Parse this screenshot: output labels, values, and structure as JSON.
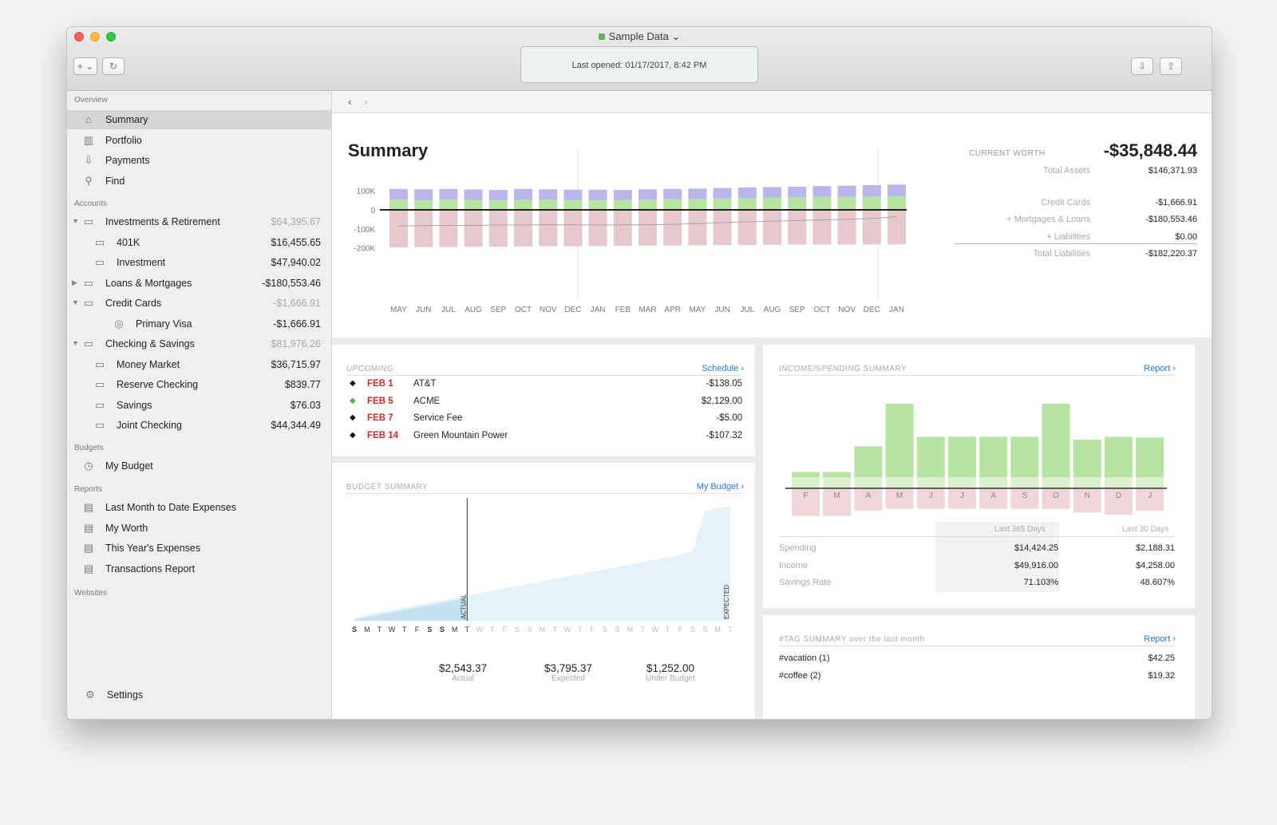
{
  "window": {
    "title": "Sample Data",
    "last_opened": "Last opened:  01/17/2017, 8:42 PM"
  },
  "toolbar": {
    "add_label": "+ ⌄",
    "refresh_icon": "refresh-icon",
    "import_icon": "import-icon",
    "export_icon": "export-icon"
  },
  "sidebar": {
    "overview_header": "Overview",
    "overview": [
      {
        "label": "Summary",
        "icon": "house-icon"
      },
      {
        "label": "Portfolio",
        "icon": "chart-icon"
      },
      {
        "label": "Payments",
        "icon": "tray-icon"
      },
      {
        "label": "Find",
        "icon": "magnifier-icon"
      }
    ],
    "accounts_header": "Accounts",
    "accounts": [
      {
        "label": "Investments & Retirement",
        "amount": "$64,395.67",
        "level": 0,
        "expander": "▼"
      },
      {
        "label": "401K",
        "amount": "$16,455.65",
        "level": 1,
        "expander": ""
      },
      {
        "label": "Investment",
        "amount": "$47,940.02",
        "level": 1,
        "expander": ""
      },
      {
        "label": "Loans & Mortgages",
        "amount": "-$180,553.46",
        "level": 0,
        "expander": "▶"
      },
      {
        "label": "Credit Cards",
        "amount": "-$1,666.91",
        "level": 0,
        "expander": "▼"
      },
      {
        "label": "Primary Visa",
        "amount": "-$1,666.91",
        "level": 2,
        "expander": ""
      },
      {
        "label": "Checking & Savings",
        "amount": "$81,976.26",
        "level": 0,
        "expander": "▼"
      },
      {
        "label": "Money Market",
        "amount": "$36,715.97",
        "level": 1,
        "expander": ""
      },
      {
        "label": "Reserve Checking",
        "amount": "$839.77",
        "level": 1,
        "expander": ""
      },
      {
        "label": "Savings",
        "amount": "$76.03",
        "level": 1,
        "expander": ""
      },
      {
        "label": "Joint Checking",
        "amount": "$44,344.49",
        "level": 1,
        "expander": ""
      }
    ],
    "budgets_header": "Budgets",
    "budgets": [
      {
        "label": "My Budget"
      }
    ],
    "reports_header": "Reports",
    "reports": [
      {
        "label": "Last Month to Date Expenses"
      },
      {
        "label": "My Worth"
      },
      {
        "label": "This Year's Expenses"
      },
      {
        "label": "Transactions Report"
      }
    ],
    "websites_header": "Websites",
    "settings_label": "Settings"
  },
  "nav": {
    "back": "‹",
    "forward": "›"
  },
  "summary": {
    "title": "Summary",
    "current_worth_label": "CURRENT WORTH",
    "current_worth": "-$35,848.44",
    "totals": [
      {
        "label": "Total Assets",
        "value": "$146,371.93"
      },
      {
        "label": "Credit Cards",
        "value": "-$1,666.91"
      },
      {
        "label": "+ Mortgages & Loans",
        "value": "-$180,553.46"
      },
      {
        "label": "+ Liabilities",
        "value": "$0.00"
      },
      {
        "label": "Total Liabilities",
        "value": "-$182,220.37"
      }
    ]
  },
  "upcoming": {
    "header": "UPCOMING",
    "link": "Schedule ›",
    "items": [
      {
        "date": "FEB 1",
        "payee": "AT&T",
        "amount": "-$138.05",
        "type": "expense"
      },
      {
        "date": "FEB 5",
        "payee": "ACME",
        "amount": "$2,129.00",
        "type": "income"
      },
      {
        "date": "FEB 7",
        "payee": "Service Fee",
        "amount": "-$5.00",
        "type": "expense"
      },
      {
        "date": "FEB 14",
        "payee": "Green Mountain Power",
        "amount": "-$107.32",
        "type": "expense"
      }
    ]
  },
  "budget": {
    "header": "BUDGET SUMMARY",
    "link": "My Budget ›",
    "actual_label": "ACTUAL",
    "expected_label": "EXPECTED",
    "days": [
      "S",
      "M",
      "T",
      "W",
      "T",
      "F",
      "S",
      "S",
      "M",
      "T",
      "W",
      "T",
      "F",
      "S",
      "S",
      "M",
      "T",
      "W",
      "T",
      "F",
      "S",
      "S",
      "M",
      "T",
      "W",
      "T",
      "F",
      "S",
      "S",
      "M",
      "T"
    ],
    "today_index": 9,
    "actual": "$2,543.37",
    "actual_sub": "Actual",
    "expected": "$3,795.37",
    "expected_sub": "Expected",
    "under": "$1,252.00",
    "under_sub": "Under Budget"
  },
  "income_spending": {
    "header": "INCOME/SPENDING SUMMARY",
    "link": "Report ›",
    "col1": "Last 365 Days",
    "col2": "Last 30 Days",
    "rows": [
      {
        "label": "Spending",
        "v365": "$14,424.25",
        "v30": "$2,188.31"
      },
      {
        "label": "Income",
        "v365": "$49,916.00",
        "v30": "$4,258.00"
      },
      {
        "label": "Savings Rate",
        "v365": "71.103%",
        "v30": "48.607%"
      }
    ]
  },
  "tags": {
    "header": "#TAG SUMMARY over the last month",
    "link": "Report ›",
    "items": [
      {
        "tag": "#vacation (1)",
        "amount": "$42.25"
      },
      {
        "tag": "#coffee (2)",
        "amount": "$19.32"
      }
    ]
  },
  "colors": {
    "assets_top": "#b8b6ea",
    "assets_bottom": "#b7e3a3",
    "liabilities": "#e6c9cc",
    "income": "#b7e3a3",
    "link": "#2a78d6",
    "date_red": "#d42a2a"
  },
  "chart_data": [
    {
      "type": "bar",
      "name": "worth",
      "categories": [
        "MAY",
        "JUN",
        "JUL",
        "AUG",
        "SEP",
        "OCT",
        "NOV",
        "DEC",
        "JAN",
        "FEB",
        "MAR",
        "APR",
        "MAY",
        "JUN",
        "JUL",
        "AUG",
        "SEP",
        "OCT",
        "NOV",
        "DEC",
        "JAN"
      ],
      "y_ticks": [
        "100K",
        "0",
        "-100K",
        "-200K"
      ],
      "ylim": [
        -200000,
        150000
      ],
      "series": [
        {
          "values": [
            55000,
            52000,
            55000,
            52000,
            50000,
            53000,
            53000,
            51000,
            52000,
            52000,
            54000,
            56000,
            57000,
            60000,
            62000,
            65000,
            66000,
            68000,
            69000,
            70000,
            72000
          ]
        },
        {
          "values": [
            110000,
            108000,
            110000,
            107000,
            105000,
            110000,
            108000,
            106000,
            106000,
            105000,
            108000,
            110000,
            112000,
            115000,
            118000,
            120000,
            122000,
            125000,
            127000,
            130000,
            133000
          ]
        },
        {
          "values": [
            -198000,
            -197000,
            -196000,
            -195000,
            -194000,
            -193000,
            -192000,
            -192000,
            -191000,
            -190000,
            -189000,
            -188000,
            -187000,
            -186000,
            -185000,
            -184000,
            -183000,
            -183000,
            -182500,
            -182000,
            -182200
          ]
        },
        {
          "values": [
            -85000,
            -83000,
            -82000,
            -82000,
            -80000,
            -80000,
            -78000,
            -79000,
            -80000,
            -79000,
            -78000,
            -76000,
            -72000,
            -68000,
            -63000,
            -60000,
            -56000,
            -53000,
            -50000,
            -45000,
            -36000
          ]
        }
      ]
    },
    {
      "type": "bar",
      "name": "income_spending",
      "categories": [
        "F",
        "M",
        "A",
        "M",
        "J",
        "J",
        "A",
        "S",
        "O",
        "N",
        "D",
        "J"
      ],
      "series": [
        {
          "values": [
            0.07,
            0.07,
            0.42,
            1.0,
            0.55,
            0.55,
            0.55,
            0.55,
            1.0,
            0.51,
            0.55,
            0.54
          ]
        },
        {
          "values": [
            0.27,
            0.27,
            0.2,
            0.17,
            0.17,
            0.17,
            0.17,
            0.17,
            0.17,
            0.22,
            0.25,
            0.2
          ]
        }
      ]
    },
    {
      "type": "area",
      "name": "budget",
      "x_count": 31,
      "series": [
        {
          "values": [
            0.02,
            0.05,
            0.07,
            0.09,
            0.11,
            0.13,
            0.15,
            0.17,
            0.19,
            0.21,
            0.23,
            0.25,
            0.27,
            0.29,
            0.31,
            0.33,
            0.35,
            0.37,
            0.39,
            0.41,
            0.43,
            0.45,
            0.47,
            0.49,
            0.51,
            0.53,
            0.55,
            0.58,
            0.92,
            0.94,
            0.96
          ]
        },
        {
          "values": [
            0.01,
            0.03,
            0.05,
            0.07,
            0.09,
            0.11,
            0.13,
            0.15,
            0.17,
            0.2
          ]
        }
      ]
    }
  ]
}
